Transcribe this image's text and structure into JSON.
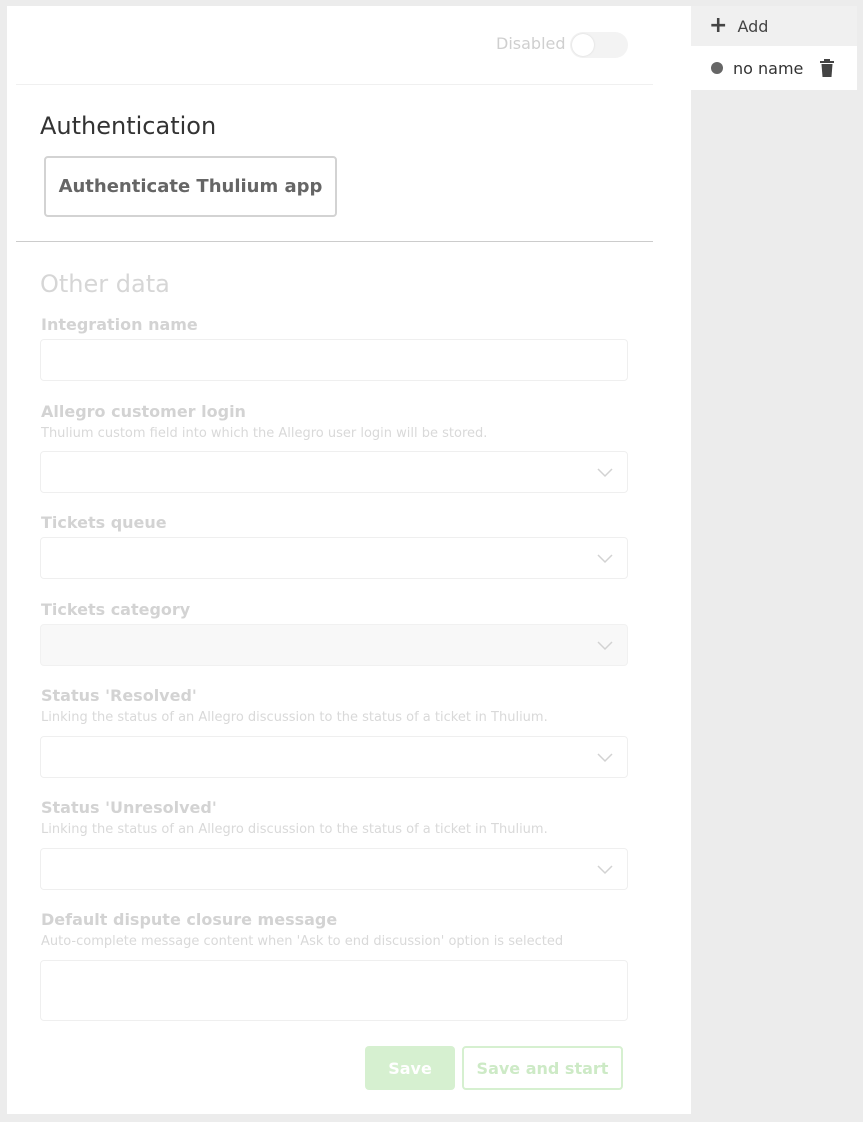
{
  "toggle": {
    "label": "Disabled",
    "state": "off"
  },
  "authentication": {
    "title": "Authentication",
    "button_label": "Authenticate Thulium app"
  },
  "other_data": {
    "title": "Other data",
    "fields": {
      "integration_name": {
        "label": "Integration name",
        "value": ""
      },
      "allegro_login": {
        "label": "Allegro customer login",
        "hint": "Thulium custom field into which the Allegro user login will be stored.",
        "value": ""
      },
      "tickets_queue": {
        "label": "Tickets queue",
        "value": ""
      },
      "tickets_category": {
        "label": "Tickets category",
        "value": ""
      },
      "status_resolved": {
        "label": "Status 'Resolved'",
        "hint": "Linking the status of an Allegro discussion to the status of a ticket in Thulium.",
        "value": ""
      },
      "status_unresolved": {
        "label": "Status 'Unresolved'",
        "hint": "Linking the status of an Allegro discussion to the status of a ticket in Thulium.",
        "value": ""
      },
      "closure_message": {
        "label": "Default dispute closure message",
        "hint": "Auto-complete message content when 'Ask to end discussion' option is selected",
        "value": ""
      }
    }
  },
  "actions": {
    "save_label": "Save",
    "save_start_label": "Save and start"
  },
  "sidebar": {
    "add_label": "Add",
    "items": [
      {
        "label": "no name"
      }
    ]
  },
  "colors": {
    "accent": "#d6f0d0",
    "text": "#333333",
    "disabled_text": "#d3d3d3"
  }
}
